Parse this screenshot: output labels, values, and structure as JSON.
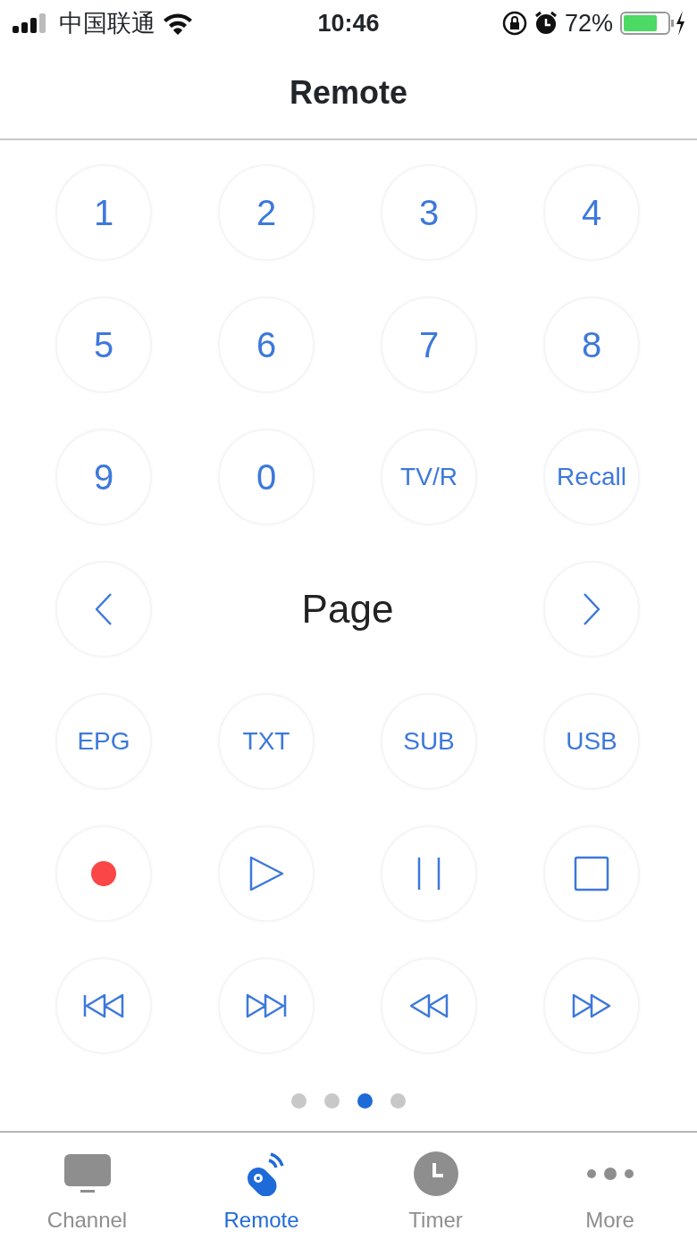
{
  "status_bar": {
    "carrier": "中国联通",
    "time": "10:46",
    "battery": "72%"
  },
  "header": {
    "title": "Remote"
  },
  "keys": [
    {
      "kind": "text",
      "label": "1"
    },
    {
      "kind": "text",
      "label": "2"
    },
    {
      "kind": "text",
      "label": "3"
    },
    {
      "kind": "text",
      "label": "4"
    },
    {
      "kind": "text",
      "label": "5"
    },
    {
      "kind": "text",
      "label": "6"
    },
    {
      "kind": "text",
      "label": "7"
    },
    {
      "kind": "text",
      "label": "8"
    },
    {
      "kind": "text",
      "label": "9"
    },
    {
      "kind": "text",
      "label": "0"
    },
    {
      "kind": "text",
      "label": "TV/R"
    },
    {
      "kind": "text",
      "label": "Recall"
    },
    {
      "kind": "prev"
    },
    {
      "kind": "caption",
      "label": "Page"
    },
    {
      "kind": "next"
    },
    {
      "kind": "text",
      "label": "EPG"
    },
    {
      "kind": "text",
      "label": "TXT"
    },
    {
      "kind": "text",
      "label": "SUB"
    },
    {
      "kind": "text",
      "label": "USB"
    },
    {
      "kind": "record"
    },
    {
      "kind": "play"
    },
    {
      "kind": "pause"
    },
    {
      "kind": "stop"
    },
    {
      "kind": "skip-back"
    },
    {
      "kind": "skip-forward"
    },
    {
      "kind": "rewind"
    },
    {
      "kind": "fast-forward"
    }
  ],
  "page_dots": [
    {
      "selected": false
    },
    {
      "selected": false
    },
    {
      "selected": true
    },
    {
      "selected": false
    }
  ],
  "tabs": [
    {
      "label": "Channel",
      "selected": false
    },
    {
      "label": "Remote",
      "selected": true
    },
    {
      "label": "Timer",
      "selected": false
    },
    {
      "label": "More",
      "selected": false
    }
  ]
}
